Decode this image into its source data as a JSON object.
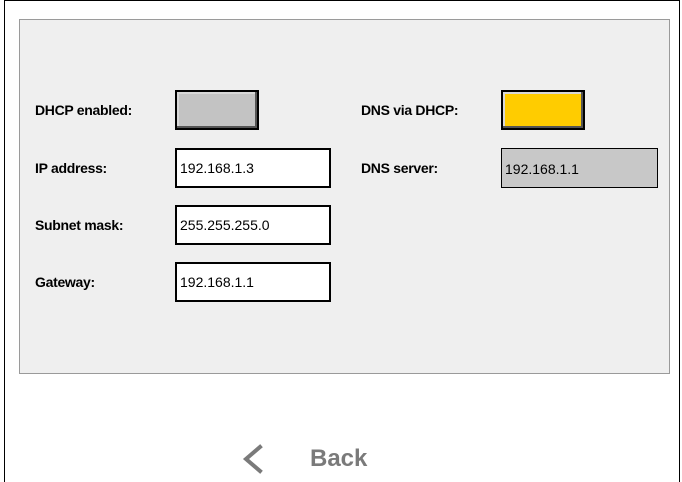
{
  "network": {
    "dhcp_enabled_label": "DHCP enabled:",
    "dhcp_enabled": false,
    "dns_via_dhcp_label": "DNS via DHCP:",
    "dns_via_dhcp": true,
    "ip_label": "IP address:",
    "ip_value": "192.168.1.3",
    "subnet_label": "Subnet mask:",
    "subnet_value": "255.255.255.0",
    "gateway_label": "Gateway:",
    "gateway_value": "192.168.1.1",
    "dns_server_label": "DNS server:",
    "dns_server_value": "192.168.1.1"
  },
  "colors": {
    "toggle_off": "#c3c3c3",
    "toggle_on": "#ffcc00",
    "panel_bg": "#efefef",
    "back_text": "#7a7a7a"
  },
  "footer": {
    "back_label": "Back",
    "back_icon": "chevron-left-icon"
  }
}
